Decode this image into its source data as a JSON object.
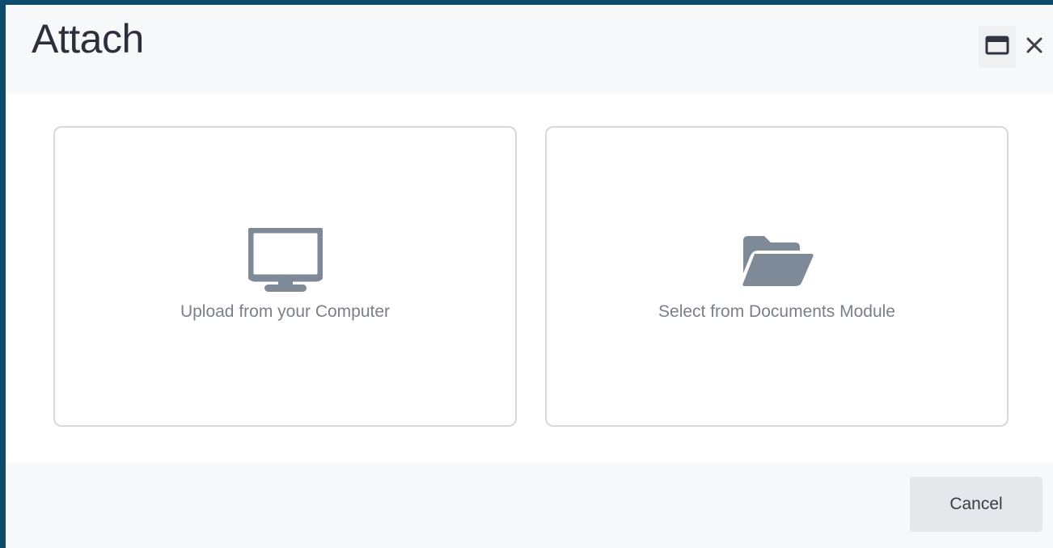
{
  "dialog": {
    "title": "Attach",
    "controls": {
      "maximize_icon": "window-maximize-icon",
      "close_icon": "close-icon"
    }
  },
  "options": [
    {
      "label": "Upload from your Computer",
      "icon": "desktop-monitor-icon"
    },
    {
      "label": "Select from Documents Module",
      "icon": "folder-open-icon"
    }
  ],
  "footer": {
    "cancel_label": "Cancel"
  },
  "colors": {
    "frame": "#0c4a6e",
    "icon": "#7f8a99",
    "header_bg": "#f7f8f9",
    "card_border": "#d6d8db"
  }
}
